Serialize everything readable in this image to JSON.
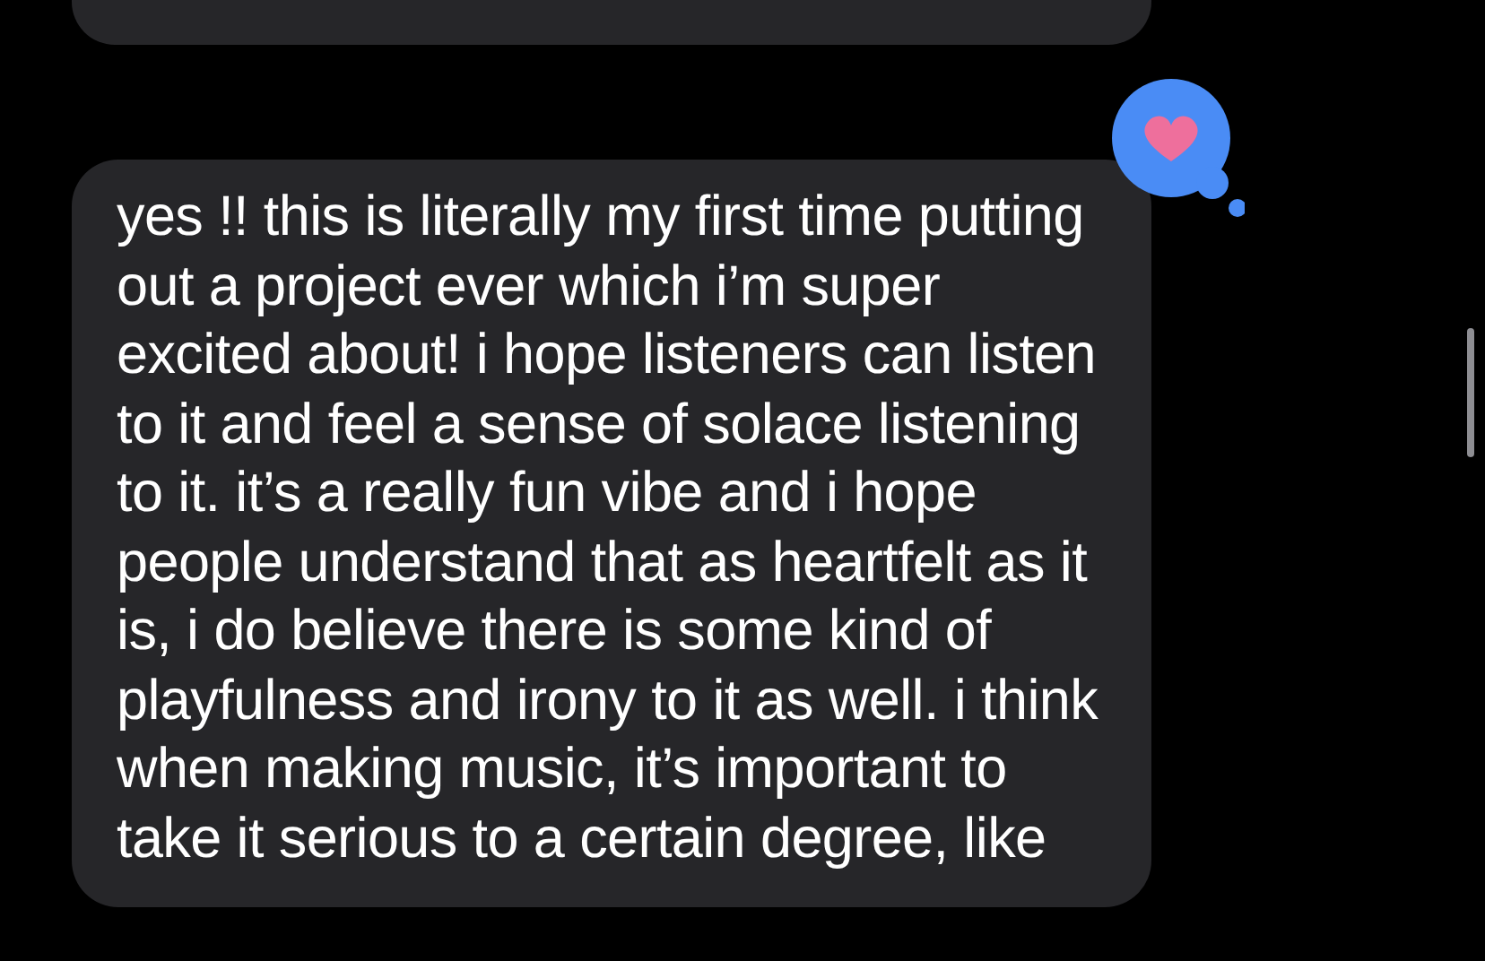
{
  "messages": [
    {
      "kind": "cut"
    },
    {
      "kind": "full",
      "tapback": true,
      "text": "yes !! this is literally my first time putting out a project ever which i’m super excited about! i hope listeners can listen to it and feel a sense of solace listening to it. it’s a really fun vibe and i hope people understand that as heartfelt as it is, i do believe there is some kind of playfulness and irony to it as well. i think when making music, it’s important to take it serious to a certain degree, like"
    }
  ]
}
